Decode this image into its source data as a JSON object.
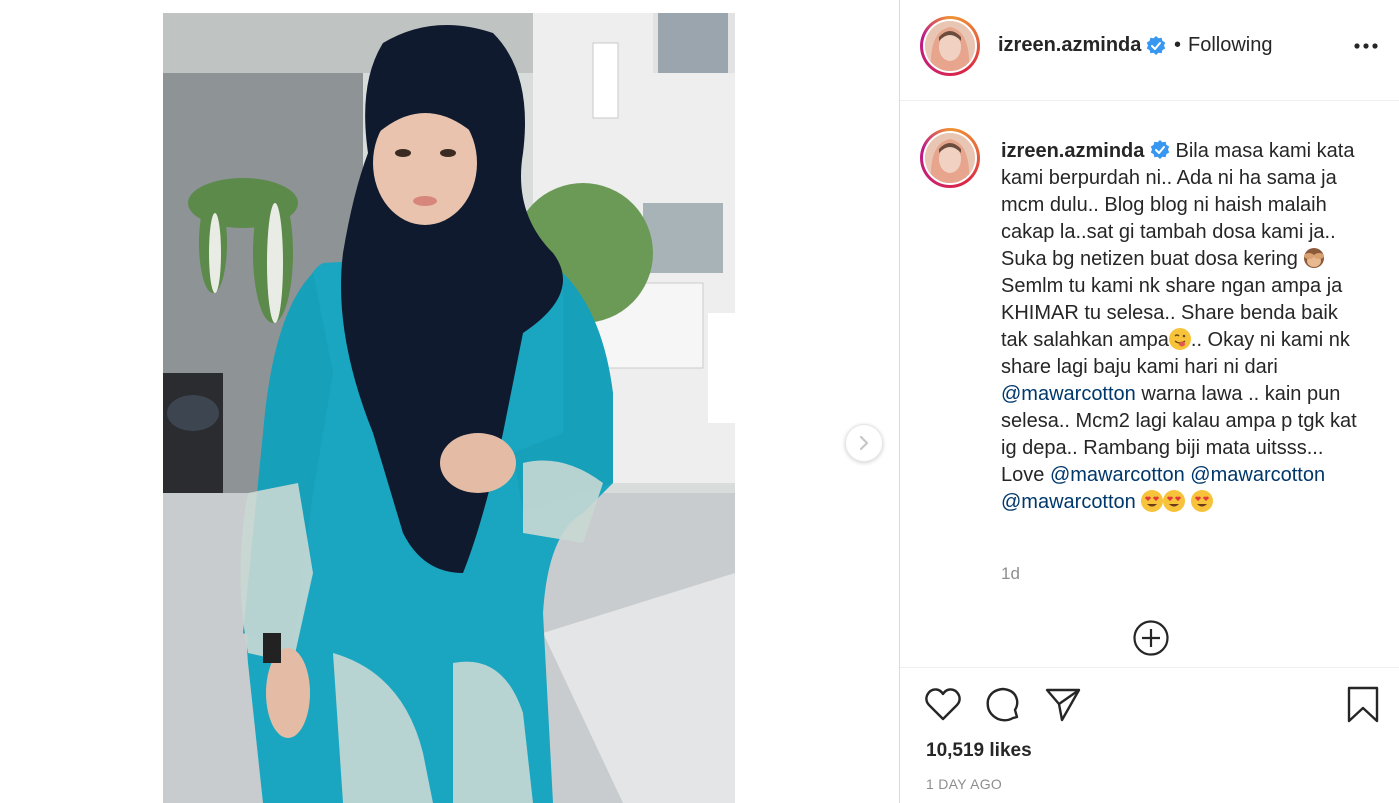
{
  "header": {
    "username": "izreen.azminda",
    "separator": "•",
    "follow_status": "Following",
    "more_icon": "more-horizontal-icon"
  },
  "caption": {
    "username": "izreen.azminda",
    "text_part1": "Bila masa kami kata kami berpurdah ni.. Ada ni ha sama ja mcm dulu.. Blog blog ni haish malaih cakap la..sat gi tambah dosa kami ja.. Suka bg netizen buat dosa kering ",
    "emoji_1": "see-no-evil-monkey",
    "text_part2": " Semlm tu kami nk share ngan ampa ja KHIMAR tu selesa.. Share benda baik tak salahkan ampa",
    "emoji_2": "tongue-face",
    "text_part3": ".. Okay ni kami nk share lagi baju kami hari ni dari ",
    "mention_1": "@mawarcotton",
    "text_part4": " warna lawa .. kain pun selesa.. Mcm2 lagi kalau ampa p tgk kat ig depa.. Rambang biji mata uitsss... Love ",
    "mention_2": "@mawarcotton",
    "mention_3": "@mawarcotton",
    "mention_4": "@mawarcotton",
    "trailing_emoji": "heart-eyes",
    "age": "1d"
  },
  "actions": {
    "like_icon": "heart-icon",
    "comment_icon": "comment-icon",
    "share_icon": "paper-plane-icon",
    "save_icon": "bookmark-icon",
    "add_comment_icon": "plus-circle-icon"
  },
  "likes_text": "10,519 likes",
  "date_text": "1 DAY AGO",
  "media": {
    "next_icon": "chevron-right-icon"
  },
  "colors": {
    "verified": "#3897f0",
    "mention": "#00376b",
    "muted": "#8e8e8e",
    "text": "#262626",
    "border": "#dbdbdb"
  }
}
